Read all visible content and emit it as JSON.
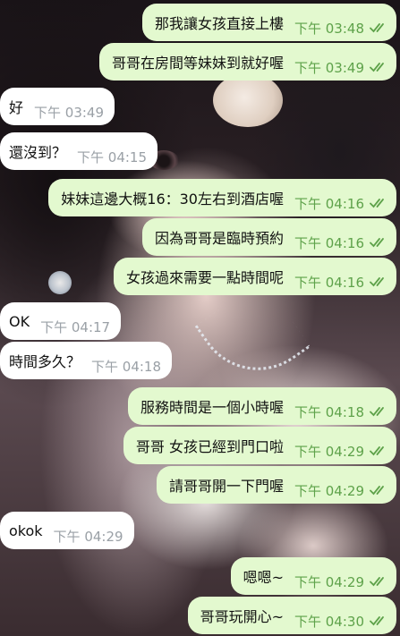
{
  "messages": [
    {
      "dir": "out",
      "text": "那我讓女孩直接上樓",
      "time": "下午 03:48"
    },
    {
      "dir": "out",
      "text": "哥哥在房間等妹妹到就好喔",
      "time": "下午 03:49"
    },
    {
      "dir": "in",
      "text": "好",
      "time": "下午 03:49"
    },
    {
      "dir": "in",
      "text": "還沒到？",
      "time": "下午 04:15"
    },
    {
      "dir": "out",
      "text": "妹妹這邊大概16：30左右到酒店喔",
      "time": "下午 04:16"
    },
    {
      "dir": "out",
      "text": "因為哥哥是臨時預約",
      "time": "下午 04:16"
    },
    {
      "dir": "out",
      "text": "女孩過來需要一點時間呢",
      "time": "下午 04:16"
    },
    {
      "dir": "in",
      "text": "OK",
      "time": "下午 04:17"
    },
    {
      "dir": "in",
      "text": "時間多久？",
      "time": "下午 04:18"
    },
    {
      "dir": "out",
      "text": "服務時間是一個小時喔",
      "time": "下午 04:18"
    },
    {
      "dir": "out",
      "text": "哥哥 女孩已經到門口啦",
      "time": "下午 04:29"
    },
    {
      "dir": "out",
      "text": "請哥哥開一下門喔",
      "time": "下午 04:29"
    },
    {
      "dir": "in",
      "text": "okok",
      "time": "下午 04:29"
    },
    {
      "dir": "out",
      "text": "嗯嗯~",
      "time": "下午 04:29"
    },
    {
      "dir": "out",
      "text": "哥哥玩開心~",
      "time": "下午 04:30"
    }
  ],
  "colors": {
    "outgoing_bubble": "#e3f9cf",
    "incoming_bubble": "#ffffff",
    "read_check": "#5ea24a",
    "incoming_time": "#9aa0a6"
  },
  "icons": {
    "read_receipt": "double-check-icon"
  }
}
